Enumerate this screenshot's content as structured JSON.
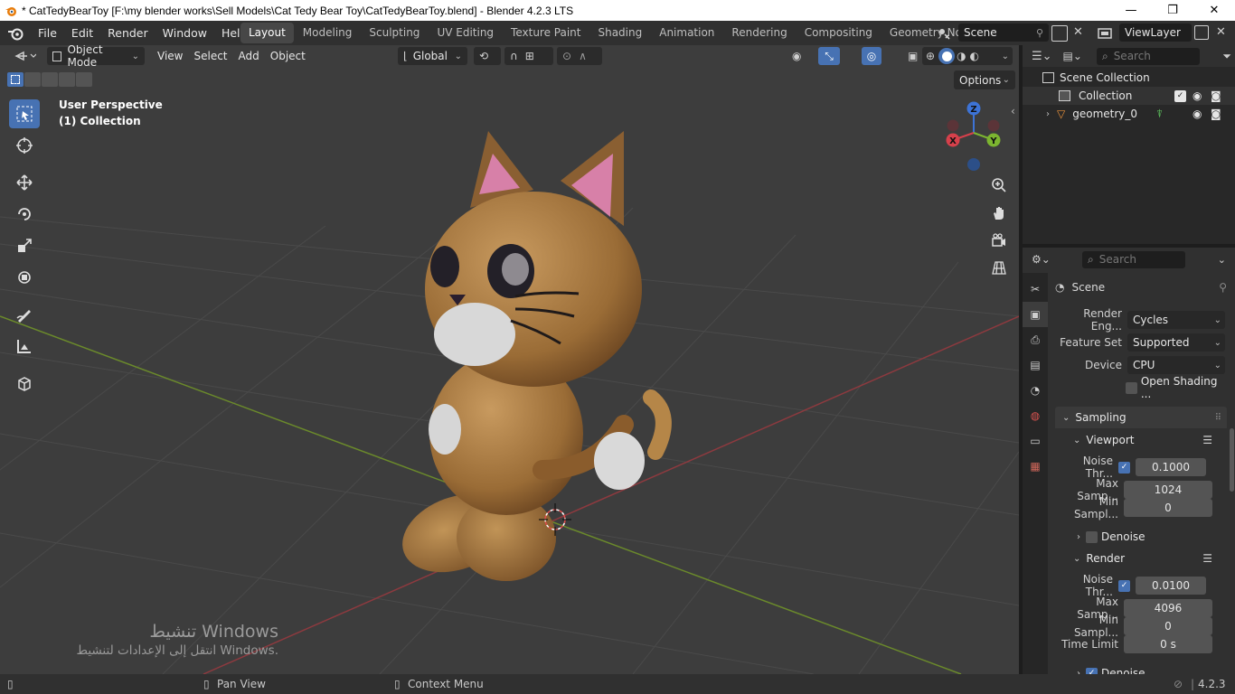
{
  "window": {
    "title": "* CatTedyBearToy [F:\\my blender works\\Sell Models\\Cat Tedy Bear Toy\\CatTedyBearToy.blend] - Blender 4.2.3 LTS",
    "minimize": "—",
    "maximize": "❐",
    "close": "✕"
  },
  "menu": [
    "File",
    "Edit",
    "Render",
    "Window",
    "Help"
  ],
  "workspaces": [
    "Layout",
    "Modeling",
    "Sculpting",
    "UV Editing",
    "Texture Paint",
    "Shading",
    "Animation",
    "Rendering",
    "Compositing",
    "Geometry Nodes"
  ],
  "active_workspace": "Layout",
  "scene": {
    "name": "Scene",
    "view_layer": "ViewLayer"
  },
  "viewport": {
    "mode": "Object Mode",
    "menus": [
      "View",
      "Select",
      "Add",
      "Object"
    ],
    "transform_orientation": "Global",
    "options_label": "Options",
    "info_line1": "User Perspective",
    "info_line2": "(1) Collection",
    "gizmo": {
      "x": "X",
      "y": "Y",
      "z": "Z"
    }
  },
  "activation": {
    "line1": "تنشيط Windows",
    "line2": "انتقل إلى الإعدادات لتنشيط Windows."
  },
  "outliner": {
    "search_placeholder": "Search",
    "root": "Scene Collection",
    "collection": "Collection",
    "object": "geometry_0"
  },
  "properties": {
    "search_placeholder": "Search",
    "context": "Scene",
    "render_engine_label": "Render Eng...",
    "render_engine": "Cycles",
    "feature_set_label": "Feature Set",
    "feature_set": "Supported",
    "device_label": "Device",
    "device": "CPU",
    "open_shading": "Open Shading ...",
    "sampling": "Sampling",
    "viewport": {
      "title": "Viewport",
      "noise_label": "Noise Thr...",
      "noise": "0.1000",
      "max_label": "Max Samp...",
      "max": "1024",
      "min_label": "Min Sampl...",
      "min": "0",
      "denoise": "Denoise"
    },
    "render": {
      "title": "Render",
      "noise_label": "Noise Thr...",
      "noise": "0.0100",
      "max_label": "Max Samp...",
      "max": "4096",
      "min_label": "Min Sampl...",
      "min": "0",
      "time_label": "Time Limit",
      "time": "0 s",
      "denoise": "Denoise"
    }
  },
  "status": {
    "pan": "Pan View",
    "context": "Context Menu",
    "version": "4.2.3"
  }
}
